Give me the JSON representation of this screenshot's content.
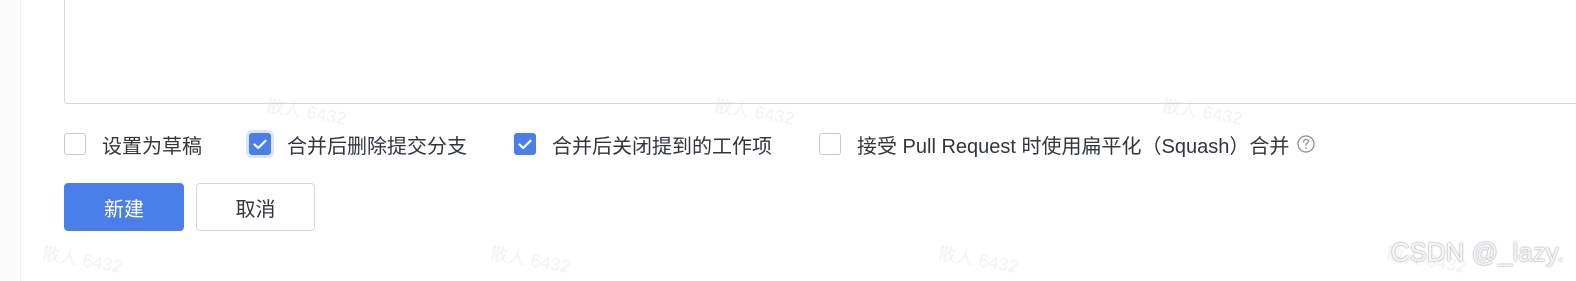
{
  "description": {
    "value": ""
  },
  "options": [
    {
      "label": "设置为草稿",
      "checked": false
    },
    {
      "label": "合并后删除提交分支",
      "checked": true
    },
    {
      "label": "合并后关闭提到的工作项",
      "checked": true
    },
    {
      "label": "接受 Pull Request 时使用扁平化（Squash）合并",
      "checked": false
    }
  ],
  "actions": {
    "create_label": "新建",
    "cancel_label": "取消"
  },
  "watermark": {
    "text": "散人 6432"
  },
  "credit": {
    "text": "CSDN @_lazy."
  },
  "colors": {
    "accent": "#4a7ee8",
    "text": "#303540",
    "border": "#d5d8de"
  }
}
